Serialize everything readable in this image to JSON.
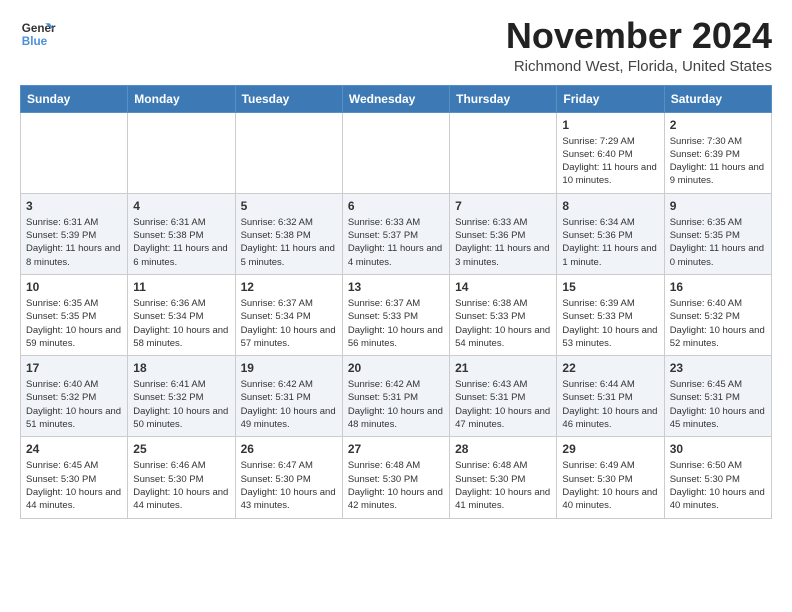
{
  "logo": {
    "line1": "General",
    "line2": "Blue"
  },
  "title": "November 2024",
  "location": "Richmond West, Florida, United States",
  "headers": [
    "Sunday",
    "Monday",
    "Tuesday",
    "Wednesday",
    "Thursday",
    "Friday",
    "Saturday"
  ],
  "weeks": [
    [
      {
        "day": "",
        "info": ""
      },
      {
        "day": "",
        "info": ""
      },
      {
        "day": "",
        "info": ""
      },
      {
        "day": "",
        "info": ""
      },
      {
        "day": "",
        "info": ""
      },
      {
        "day": "1",
        "info": "Sunrise: 7:29 AM\nSunset: 6:40 PM\nDaylight: 11 hours and 10 minutes."
      },
      {
        "day": "2",
        "info": "Sunrise: 7:30 AM\nSunset: 6:39 PM\nDaylight: 11 hours and 9 minutes."
      }
    ],
    [
      {
        "day": "3",
        "info": "Sunrise: 6:31 AM\nSunset: 5:39 PM\nDaylight: 11 hours and 8 minutes."
      },
      {
        "day": "4",
        "info": "Sunrise: 6:31 AM\nSunset: 5:38 PM\nDaylight: 11 hours and 6 minutes."
      },
      {
        "day": "5",
        "info": "Sunrise: 6:32 AM\nSunset: 5:38 PM\nDaylight: 11 hours and 5 minutes."
      },
      {
        "day": "6",
        "info": "Sunrise: 6:33 AM\nSunset: 5:37 PM\nDaylight: 11 hours and 4 minutes."
      },
      {
        "day": "7",
        "info": "Sunrise: 6:33 AM\nSunset: 5:36 PM\nDaylight: 11 hours and 3 minutes."
      },
      {
        "day": "8",
        "info": "Sunrise: 6:34 AM\nSunset: 5:36 PM\nDaylight: 11 hours and 1 minute."
      },
      {
        "day": "9",
        "info": "Sunrise: 6:35 AM\nSunset: 5:35 PM\nDaylight: 11 hours and 0 minutes."
      }
    ],
    [
      {
        "day": "10",
        "info": "Sunrise: 6:35 AM\nSunset: 5:35 PM\nDaylight: 10 hours and 59 minutes."
      },
      {
        "day": "11",
        "info": "Sunrise: 6:36 AM\nSunset: 5:34 PM\nDaylight: 10 hours and 58 minutes."
      },
      {
        "day": "12",
        "info": "Sunrise: 6:37 AM\nSunset: 5:34 PM\nDaylight: 10 hours and 57 minutes."
      },
      {
        "day": "13",
        "info": "Sunrise: 6:37 AM\nSunset: 5:33 PM\nDaylight: 10 hours and 56 minutes."
      },
      {
        "day": "14",
        "info": "Sunrise: 6:38 AM\nSunset: 5:33 PM\nDaylight: 10 hours and 54 minutes."
      },
      {
        "day": "15",
        "info": "Sunrise: 6:39 AM\nSunset: 5:33 PM\nDaylight: 10 hours and 53 minutes."
      },
      {
        "day": "16",
        "info": "Sunrise: 6:40 AM\nSunset: 5:32 PM\nDaylight: 10 hours and 52 minutes."
      }
    ],
    [
      {
        "day": "17",
        "info": "Sunrise: 6:40 AM\nSunset: 5:32 PM\nDaylight: 10 hours and 51 minutes."
      },
      {
        "day": "18",
        "info": "Sunrise: 6:41 AM\nSunset: 5:32 PM\nDaylight: 10 hours and 50 minutes."
      },
      {
        "day": "19",
        "info": "Sunrise: 6:42 AM\nSunset: 5:31 PM\nDaylight: 10 hours and 49 minutes."
      },
      {
        "day": "20",
        "info": "Sunrise: 6:42 AM\nSunset: 5:31 PM\nDaylight: 10 hours and 48 minutes."
      },
      {
        "day": "21",
        "info": "Sunrise: 6:43 AM\nSunset: 5:31 PM\nDaylight: 10 hours and 47 minutes."
      },
      {
        "day": "22",
        "info": "Sunrise: 6:44 AM\nSunset: 5:31 PM\nDaylight: 10 hours and 46 minutes."
      },
      {
        "day": "23",
        "info": "Sunrise: 6:45 AM\nSunset: 5:31 PM\nDaylight: 10 hours and 45 minutes."
      }
    ],
    [
      {
        "day": "24",
        "info": "Sunrise: 6:45 AM\nSunset: 5:30 PM\nDaylight: 10 hours and 44 minutes."
      },
      {
        "day": "25",
        "info": "Sunrise: 6:46 AM\nSunset: 5:30 PM\nDaylight: 10 hours and 44 minutes."
      },
      {
        "day": "26",
        "info": "Sunrise: 6:47 AM\nSunset: 5:30 PM\nDaylight: 10 hours and 43 minutes."
      },
      {
        "day": "27",
        "info": "Sunrise: 6:48 AM\nSunset: 5:30 PM\nDaylight: 10 hours and 42 minutes."
      },
      {
        "day": "28",
        "info": "Sunrise: 6:48 AM\nSunset: 5:30 PM\nDaylight: 10 hours and 41 minutes."
      },
      {
        "day": "29",
        "info": "Sunrise: 6:49 AM\nSunset: 5:30 PM\nDaylight: 10 hours and 40 minutes."
      },
      {
        "day": "30",
        "info": "Sunrise: 6:50 AM\nSunset: 5:30 PM\nDaylight: 10 hours and 40 minutes."
      }
    ]
  ]
}
